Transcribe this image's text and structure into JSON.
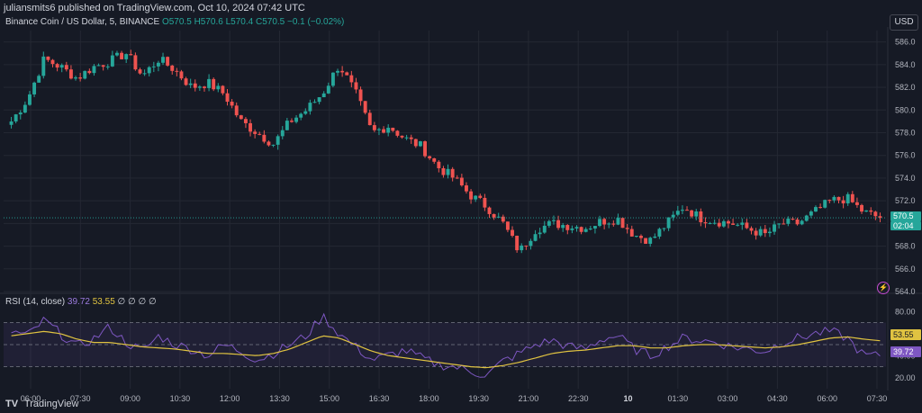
{
  "header": {
    "published": "juliansmits6 published on TradingView.com, Oct 10, 2024 07:42 UTC"
  },
  "symbol_line": {
    "name": "Binance Coin / US Dollar, 5, BINANCE",
    "open": "O570.5",
    "high": "H570.6",
    "low": "L570.4",
    "close": "C570.5",
    "change": "−0.1 (−0.02%)"
  },
  "currency": "USD",
  "price_tag": "570.5",
  "timer_tag": "02:04",
  "rsi_header": {
    "label": "RSI (14, close)",
    "rsi_value": "39.72",
    "ma_value": "53.55",
    "extras": "∅ ∅ ∅ ∅"
  },
  "rsi_tags": {
    "ma": "53.55",
    "rsi": "39.72"
  },
  "footer": {
    "logo": "TV",
    "brand": "TradingView"
  },
  "colors": {
    "background": "#161a25",
    "up": "#26a69a",
    "down": "#ef5350",
    "rsi": "#7e57c2",
    "rsi_ma": "#e0c341",
    "grid": "#242833"
  },
  "chart_data": [
    {
      "type": "candlestick",
      "title": "Binance Coin / US Dollar, 5, BINANCE",
      "ylim": [
        564.0,
        587.0
      ],
      "y_ticks": [
        "586.0",
        "584.0",
        "582.0",
        "580.0",
        "578.0",
        "576.0",
        "574.0",
        "572.0",
        "570.0",
        "568.0",
        "566.0",
        "564.0"
      ],
      "x_ticks": [
        "06:00",
        "07:30",
        "09:00",
        "10:30",
        "12:00",
        "13:30",
        "15:00",
        "16:30",
        "18:00",
        "19:30",
        "21:00",
        "22:30",
        "10",
        "01:30",
        "03:00",
        "04:30",
        "06:00",
        "07:30"
      ],
      "last_price": 570.5,
      "anchors": {
        "close": [
          579.0,
          581.0,
          584.5,
          583.8,
          582.8,
          583.8,
          584.3,
          585.0,
          583.0,
          584.5,
          583.5,
          582.0,
          582.4,
          581.4,
          579.0,
          578.0,
          577.0,
          579.0,
          580.0,
          581.5,
          584.0,
          581.5,
          578.0,
          578.6,
          577.5,
          576.8,
          575.0,
          574.0,
          572.5,
          571.5,
          570.0,
          567.5,
          569.5,
          570.0,
          569.8,
          569.6,
          570.2,
          570.4,
          569.0,
          568.5,
          570.0,
          571.5,
          570.5,
          570.2,
          570.0,
          569.5,
          569.0,
          570.0,
          570.0,
          571.0,
          572.0,
          572.2,
          571.0,
          570.5
        ]
      }
    },
    {
      "type": "line",
      "title": "RSI (14, close)",
      "ylim": [
        10.0,
        90.0
      ],
      "y_ticks": [
        "80.00",
        "60.00",
        "40.00",
        "20.00"
      ],
      "bands": [
        70,
        50,
        30
      ],
      "series": [
        {
          "name": "RSI",
          "values": [
            62,
            58,
            72,
            60,
            48,
            55,
            66,
            52,
            44,
            58,
            50,
            46,
            40,
            50,
            44,
            36,
            42,
            50,
            58,
            76,
            60,
            48,
            36,
            40,
            45,
            38,
            32,
            30,
            26,
            22,
            35,
            42,
            50,
            54,
            48,
            46,
            55,
            58,
            46,
            40,
            48,
            56,
            54,
            52,
            48,
            46,
            44,
            52,
            56,
            60,
            62,
            56,
            40,
            39.72
          ]
        },
        {
          "name": "RSI MA",
          "values": [
            58,
            60,
            62,
            60,
            55,
            52,
            52,
            50,
            48,
            47,
            46,
            44,
            42,
            42,
            41,
            40,
            42,
            46,
            52,
            58,
            56,
            50,
            44,
            40,
            38,
            36,
            34,
            32,
            30,
            29,
            31,
            34,
            38,
            42,
            44,
            45,
            47,
            49,
            49,
            47,
            47,
            49,
            50,
            50,
            49,
            48,
            47,
            48,
            50,
            53,
            56,
            57,
            55,
            53.55
          ]
        }
      ]
    }
  ]
}
